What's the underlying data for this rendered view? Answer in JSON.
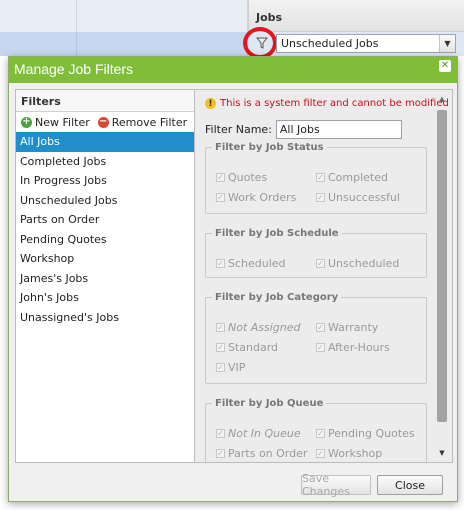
{
  "background": {
    "jobs_column_title": "Jobs",
    "filter_select": {
      "selected": "Unscheduled Jobs"
    }
  },
  "dialog": {
    "title": "Manage Job Filters",
    "filters_panel": {
      "header": "Filters",
      "new_filter_label": "New Filter",
      "remove_filter_label": "Remove Filter",
      "items": [
        {
          "label": "All Jobs",
          "selected": true
        },
        {
          "label": "Completed Jobs"
        },
        {
          "label": "In Progress Jobs"
        },
        {
          "label": "Unscheduled Jobs"
        },
        {
          "label": "Parts on Order"
        },
        {
          "label": "Pending Quotes"
        },
        {
          "label": "Workshop"
        },
        {
          "label": "James's Jobs"
        },
        {
          "label": "John's Jobs"
        },
        {
          "label": "Unassigned's Jobs"
        }
      ]
    },
    "details": {
      "warning": "This is a system filter and cannot be modified",
      "filter_name_label": "Filter Name:",
      "filter_name_value": "All Jobs",
      "groups": {
        "status": {
          "legend": "Filter by Job Status",
          "options": [
            "Quotes",
            "Completed",
            "Work Orders",
            "Unsuccessful"
          ]
        },
        "schedule": {
          "legend": "Filter by Job Schedule",
          "options": [
            "Scheduled",
            "Unscheduled"
          ]
        },
        "category": {
          "legend": "Filter by Job Category",
          "options": [
            "Not Assigned",
            "Warranty",
            "Standard",
            "After-Hours",
            "VIP"
          ]
        },
        "queue": {
          "legend": "Filter by Job Queue",
          "options": [
            "Not In Queue",
            "Pending Quotes",
            "Parts on Order",
            "Workshop"
          ]
        }
      }
    },
    "buttons": {
      "save": "Save Changes",
      "close": "Close"
    }
  },
  "colors": {
    "titlebar": "#80be3a",
    "selected_item": "#1f8ecb",
    "warning_text": "#c8101e",
    "highlight_ring": "#e3161b"
  }
}
